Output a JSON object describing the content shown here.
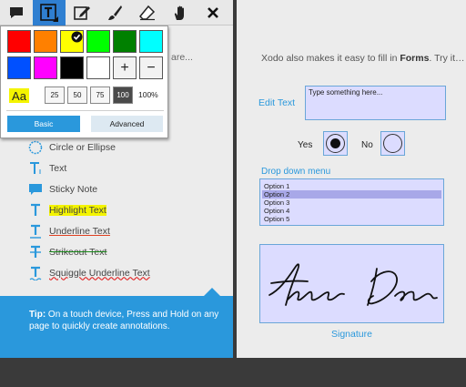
{
  "toolbar": {
    "tools": [
      {
        "name": "comment-tool-icon"
      },
      {
        "name": "text-tool-icon",
        "active": true
      },
      {
        "name": "signature-edit-icon"
      },
      {
        "name": "brush-icon"
      },
      {
        "name": "eraser-icon"
      },
      {
        "name": "pan-hand-icon"
      },
      {
        "name": "close-icon"
      }
    ],
    "active_color": "#2f7fd1"
  },
  "popup": {
    "colors_row1": [
      "#ff0000",
      "#ff8000",
      "#ffff00",
      "#00ff00",
      "#008000",
      "#00ffff"
    ],
    "colors_row2": [
      "#0050ff",
      "#ff00ff",
      "#000000",
      "#ffffff"
    ],
    "selected_color": "#ffff00",
    "add_label": "+",
    "remove_label": "−",
    "preview_text": "Aa",
    "opacity_options": [
      "25",
      "50",
      "75",
      "100"
    ],
    "selected_opacity": "100",
    "opacity_value": "100%",
    "basic_label": "Basic",
    "advanced_label": "Advanced"
  },
  "left": {
    "faded_text": "are...",
    "annotations": [
      {
        "label": "Circle or Ellipse",
        "icon": "circle-icon"
      },
      {
        "label": "Text",
        "icon": "text-t-icon"
      },
      {
        "label": "Sticky Note",
        "icon": "sticky-note-icon"
      },
      {
        "label": "Highlight Text",
        "icon": "highlight-icon"
      },
      {
        "label": "Underline Text",
        "icon": "underline-icon"
      },
      {
        "label": "Strikeout Text",
        "icon": "strikeout-icon"
      },
      {
        "label": "Squiggle Underline Text",
        "icon": "squiggle-icon"
      }
    ],
    "tip_bold": "Tip:",
    "tip_text": " On a touch device, Press and Hold on any page to quickly create annotations."
  },
  "right": {
    "intro_prefix": "Xodo also makes it easy to fill in ",
    "intro_bold": "Forms",
    "intro_suffix": ". Try it…",
    "edit_text_label": "Edit Text",
    "edit_text_value": "Type something here...",
    "yes_label": "Yes",
    "no_label": "No",
    "yes_selected": true,
    "dropdown_label": "Drop down menu",
    "options": [
      "Option 1",
      "Option 2",
      "Option 3",
      "Option 4",
      "Option 5"
    ],
    "selected_option": "Option 2",
    "signature_label": "Signature",
    "field_color": "#dcdcff",
    "accent_color": "#2a98dc"
  }
}
